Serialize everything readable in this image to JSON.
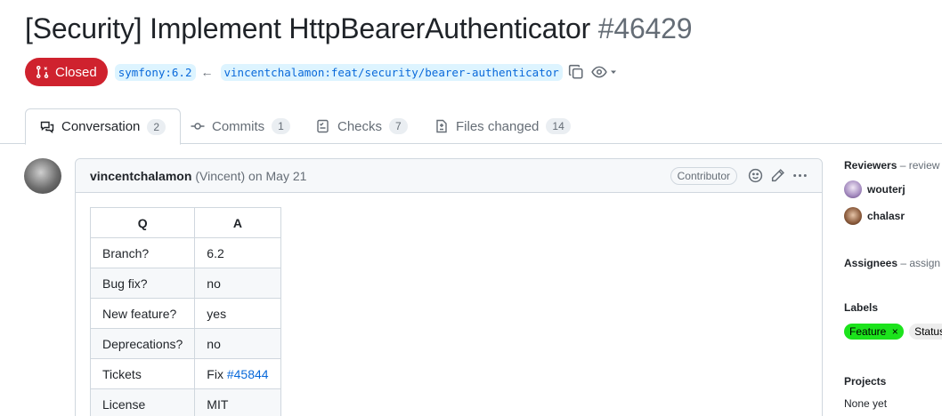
{
  "pr": {
    "title": "[Security] Implement HttpBearerAuthenticator",
    "number": "#46429",
    "state": "Closed",
    "base_branch": "symfony:6.2",
    "arrow": "←",
    "head_branch": "vincentchalamon:feat/security/bearer-authenticator"
  },
  "tabs": [
    {
      "label": "Conversation",
      "count": "2",
      "icon": "comment-discussion-icon"
    },
    {
      "label": "Commits",
      "count": "1",
      "icon": "git-commit-icon"
    },
    {
      "label": "Checks",
      "count": "7",
      "icon": "checklist-icon"
    },
    {
      "label": "Files changed",
      "count": "14",
      "icon": "file-diff-icon"
    }
  ],
  "comment": {
    "author": "vincentchalamon",
    "author_detail": "(Vincent) on May 21",
    "role": "Contributor",
    "table": {
      "headers": [
        "Q",
        "A"
      ],
      "rows": [
        {
          "q": "Branch?",
          "a": "6.2"
        },
        {
          "q": "Bug fix?",
          "a": "no"
        },
        {
          "q": "New feature?",
          "a": "yes"
        },
        {
          "q": "Deprecations?",
          "a": "no"
        },
        {
          "q": "Tickets",
          "a_prefix": "Fix ",
          "a_link": "#45844"
        },
        {
          "q": "License",
          "a": "MIT"
        }
      ]
    }
  },
  "sidebar": {
    "reviewers": {
      "title": "Reviewers",
      "muted": "– review",
      "people": [
        "wouterj",
        "chalasr"
      ]
    },
    "assignees": {
      "title": "Assignees",
      "muted": "– assign"
    },
    "labels": {
      "title": "Labels",
      "items": [
        {
          "name": "Feature",
          "remove": "×",
          "color": "#1ce31c"
        },
        {
          "name": "Status",
          "color": "#ededed"
        }
      ]
    },
    "projects": {
      "title": "Projects",
      "value": "None yet"
    }
  },
  "colors": {
    "closed": "#cf222e",
    "link": "#0969da",
    "branch_bg": "#ddf4ff"
  }
}
